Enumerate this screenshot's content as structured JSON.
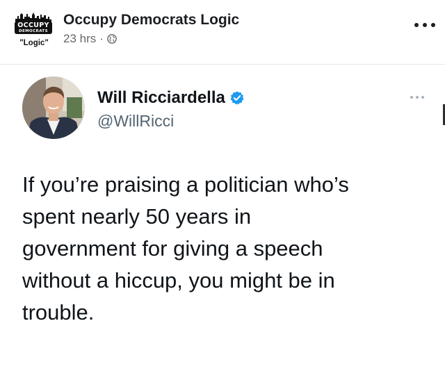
{
  "post": {
    "page_name": "Occupy Democrats Logic",
    "time": "23 hrs",
    "separator": "·",
    "logo": {
      "line1": "OCCUPY",
      "line2": "DEMOCRATS",
      "caption": "\"Logic\""
    },
    "icons": {
      "audience": "globe-icon",
      "menu": "more-horizontal-icon"
    }
  },
  "tweet": {
    "author_name": "Will Ricciardella",
    "handle": "@WillRicci",
    "verified": true,
    "lines": [
      "If you’re praising a politician who’s",
      "spent nearly 50 years in",
      "government for giving a speech",
      "without a hiccup, you might be in",
      "trouble."
    ],
    "icons": {
      "verified": "verified-badge-icon",
      "menu": "more-horizontal-icon"
    }
  },
  "colors": {
    "text_primary": "#1c1e21",
    "text_secondary": "#65676b",
    "twitter_blue": "#1d9bf0",
    "handle_gray": "#536471"
  }
}
